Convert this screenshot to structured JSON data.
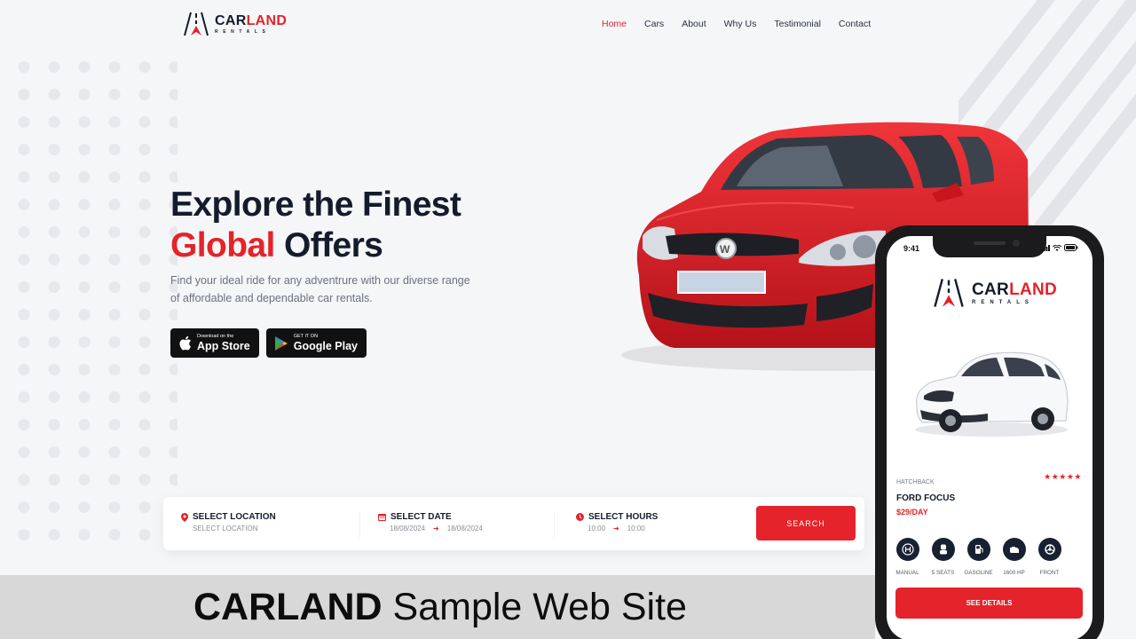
{
  "brand": {
    "name_part1": "CAR",
    "name_part2": "LAND",
    "sub": "RENTALS",
    "accent": "#e4232a",
    "dark": "#141c2c"
  },
  "nav": [
    "Home",
    "Cars",
    "About",
    "Why Us",
    "Testimonial",
    "Contact"
  ],
  "nav_active": "Home",
  "hero": {
    "title_line1": "Explore the Finest",
    "title_red": "Global",
    "title_rest": " Offers",
    "description": "Find your ideal ride for any adventrure with our diverse range of affordable and dependable car rentals."
  },
  "stores": {
    "apple": {
      "small": "Download on the",
      "big": "App Store",
      "icon": "apple-icon"
    },
    "google": {
      "small": "GET IT ON",
      "big": "Google Play",
      "icon": "google-play-icon"
    }
  },
  "booking": {
    "location": {
      "label": "SELECT LOCATION",
      "value": "SELECT LOCATION",
      "icon": "location-pin-icon"
    },
    "date": {
      "label": "SELECT DATE",
      "from": "18/08/2024",
      "to": "18/08/2024",
      "icon": "calendar-icon"
    },
    "hours": {
      "label": "SELECT HOURS",
      "from": "10:00",
      "to": "10:00",
      "icon": "clock-icon"
    },
    "search_label": "SEARCH"
  },
  "banner": {
    "bold": "CARLAND",
    "rest": " Sample Web Site"
  },
  "phone": {
    "time": "9:41",
    "car_type": "HATCHBACK",
    "car_name": "FORD FOCUS",
    "price": "$29/DAY",
    "rating": 5,
    "stars": "★★★★★",
    "specs": [
      {
        "label": "MANUAL",
        "icon": "gearbox-icon"
      },
      {
        "label": "5 SEATS",
        "icon": "seat-icon"
      },
      {
        "label": "GASOLINE",
        "icon": "fuel-icon"
      },
      {
        "label": "1600 HP",
        "icon": "engine-icon"
      },
      {
        "label": "FRONT",
        "icon": "wheel-icon"
      }
    ],
    "details_label": "SEE DETAILS"
  }
}
